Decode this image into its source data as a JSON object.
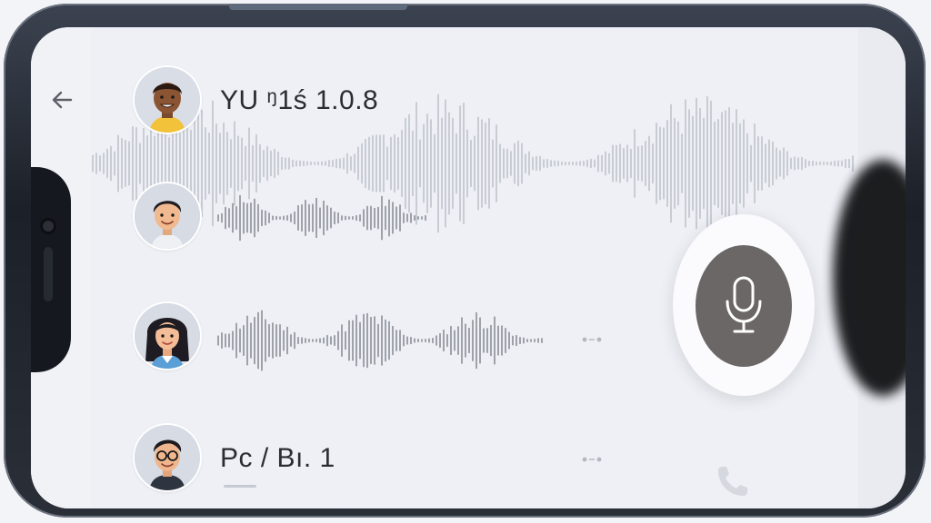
{
  "header": {
    "back_icon": "arrow-left-icon"
  },
  "participants": [
    {
      "name": "YU ᵑ1ś 1.0.8",
      "avatar_icon": "avatar-man-dark-skin-icon"
    },
    {
      "name": "",
      "avatar_icon": "avatar-man-light-icon"
    },
    {
      "name": "",
      "avatar_icon": "avatar-woman-icon"
    },
    {
      "name": "Pc /  Bı. 1",
      "avatar_icon": "avatar-man-glasses-icon"
    }
  ],
  "controls": {
    "mic_icon": "microphone-icon",
    "call_icon": "phone-icon"
  },
  "colors": {
    "mic_button": "#6b6766",
    "wave": "#8b8f96",
    "background": "#eef0f6"
  }
}
